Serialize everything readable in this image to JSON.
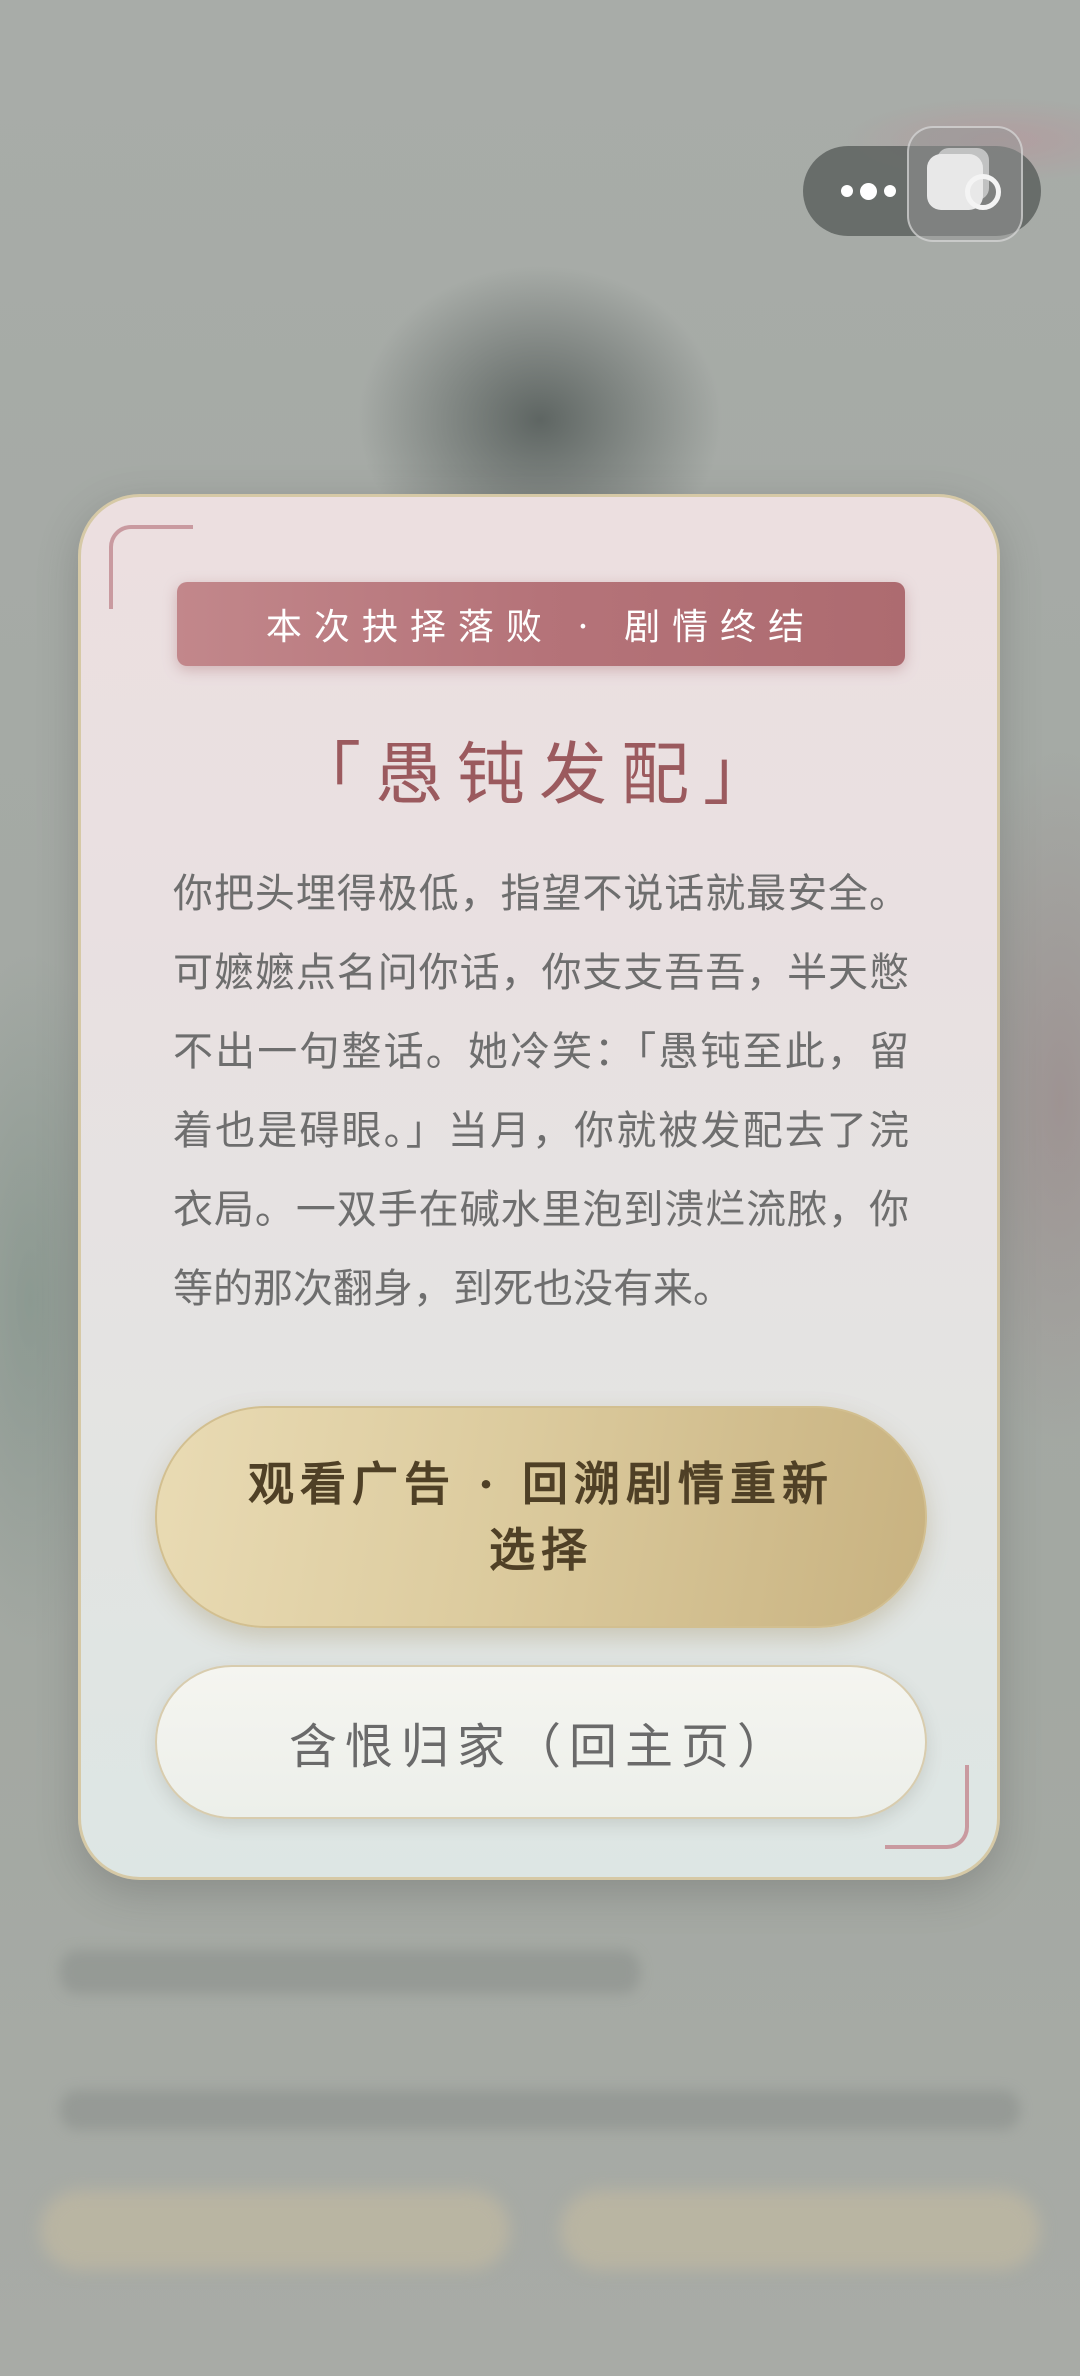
{
  "capsule_menu": {
    "more_icon": "more-dots-icon",
    "close_icon": "close-miniprogram-icon"
  },
  "dialog": {
    "banner": "本次抉择落败 · 剧情终结",
    "title": "「愚钝发配」",
    "body": "你把头埋得极低，指望不说话就最安全。可嬷嬷点名问你话，你支支吾吾，半天憋不出一句整话。她冷笑：「愚钝至此，留着也是碍眼。」当月，你就被发配去了浣衣局。一双手在碱水里泡到溃烂流脓，你等的那次翻身，到死也没有来。",
    "primary_button": "观看广告 · 回溯剧情重新选择",
    "secondary_button": "含恨归家（回主页）"
  },
  "colors": {
    "banner": "#b57379",
    "title": "#9b5a5e",
    "primary_button": "#dccb9e",
    "card_border": "#d6c9a6"
  }
}
